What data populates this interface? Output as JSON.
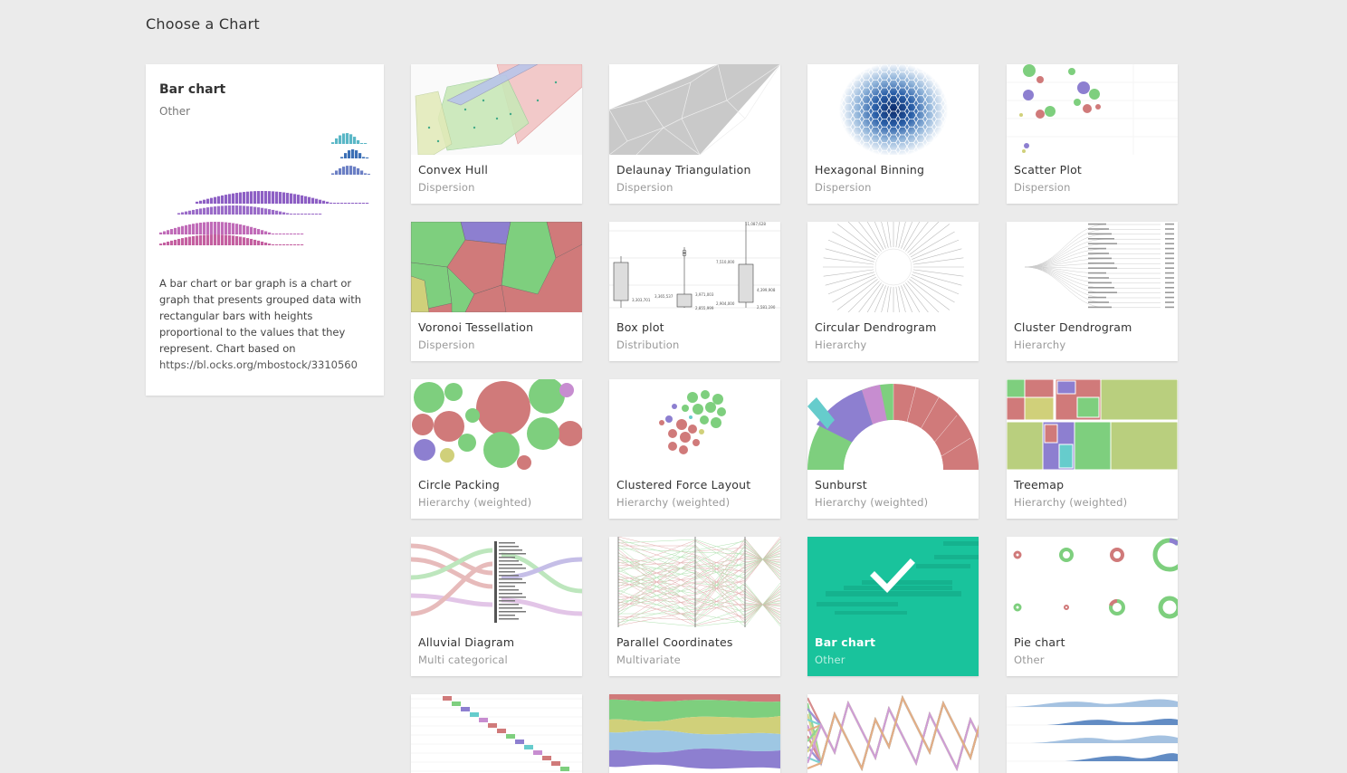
{
  "page": {
    "title": "Choose a Chart"
  },
  "selected": {
    "name": "Bar chart",
    "category": "Other",
    "description_lines": [
      "A bar chart or bar graph is a chart or",
      "graph that presents grouped data with",
      "rectangular bars with heights",
      "proportional to the values that they",
      "represent. Chart based on"
    ],
    "link": "https://bl.ocks.org/mbostock/3310560"
  },
  "charts": [
    {
      "id": "convex-hull",
      "name": "Convex Hull",
      "category": "Dispersion"
    },
    {
      "id": "delaunay-triangulation",
      "name": "Delaunay Triangulation",
      "category": "Dispersion"
    },
    {
      "id": "hexagonal-binning",
      "name": "Hexagonal Binning",
      "category": "Dispersion"
    },
    {
      "id": "scatter-plot",
      "name": "Scatter Plot",
      "category": "Dispersion"
    },
    {
      "id": "voronoi-tessellation",
      "name": "Voronoi Tessellation",
      "category": "Dispersion"
    },
    {
      "id": "box-plot",
      "name": "Box plot",
      "category": "Distribution"
    },
    {
      "id": "circular-dendrogram",
      "name": "Circular Dendrogram",
      "category": "Hierarchy"
    },
    {
      "id": "cluster-dendrogram",
      "name": "Cluster Dendrogram",
      "category": "Hierarchy"
    },
    {
      "id": "circle-packing",
      "name": "Circle Packing",
      "category": "Hierarchy (weighted)"
    },
    {
      "id": "clustered-force-layout",
      "name": "Clustered Force Layout",
      "category": "Hierarchy (weighted)"
    },
    {
      "id": "sunburst",
      "name": "Sunburst",
      "category": "Hierarchy (weighted)"
    },
    {
      "id": "treemap",
      "name": "Treemap",
      "category": "Hierarchy (weighted)"
    },
    {
      "id": "alluvial-diagram",
      "name": "Alluvial Diagram",
      "category": "Multi categorical"
    },
    {
      "id": "parallel-coordinates",
      "name": "Parallel Coordinates",
      "category": "Multivariate"
    },
    {
      "id": "bar-chart",
      "name": "Bar chart",
      "category": "Other"
    },
    {
      "id": "pie-chart",
      "name": "Pie chart",
      "category": "Other"
    },
    {
      "id": "gantt-chart",
      "name": "",
      "category": ""
    },
    {
      "id": "streamgraph",
      "name": "",
      "category": ""
    },
    {
      "id": "bump-chart",
      "name": "",
      "category": ""
    },
    {
      "id": "horizon-graph",
      "name": "",
      "category": ""
    }
  ],
  "box_plot_thumb_labels": [
    "11,087,628",
    "7,510,000",
    "3,365,537",
    "3,971,003",
    "3,303,701",
    "2,855,999",
    "2,904,000",
    "4,399,908",
    "2,581,190"
  ],
  "colors": {
    "background": "#ebebeb",
    "selected": "#19c39c",
    "green": "#7ecf7e",
    "red": "#d07a7a",
    "purple": "#8d7fd0",
    "blue": "#3b6fb5"
  }
}
